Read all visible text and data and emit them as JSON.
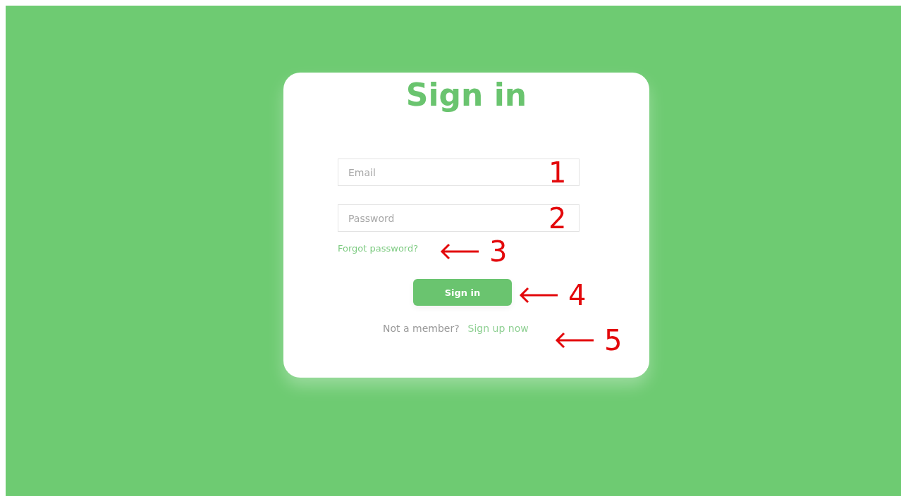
{
  "title": "Sign in",
  "fields": [
    {
      "placeholder": "Email"
    },
    {
      "placeholder": "Password"
    }
  ],
  "forgot_link": "Forgot password?",
  "submit_button": "Sign in",
  "signup": {
    "prompt": "Not a member?",
    "link": "Sign up now"
  },
  "annotations": [
    {
      "kind": "number",
      "label": "1"
    },
    {
      "kind": "number",
      "label": "2"
    },
    {
      "kind": "arrow",
      "label": "3"
    },
    {
      "kind": "arrow",
      "label": "4"
    },
    {
      "kind": "arrow",
      "label": "5"
    }
  ]
}
